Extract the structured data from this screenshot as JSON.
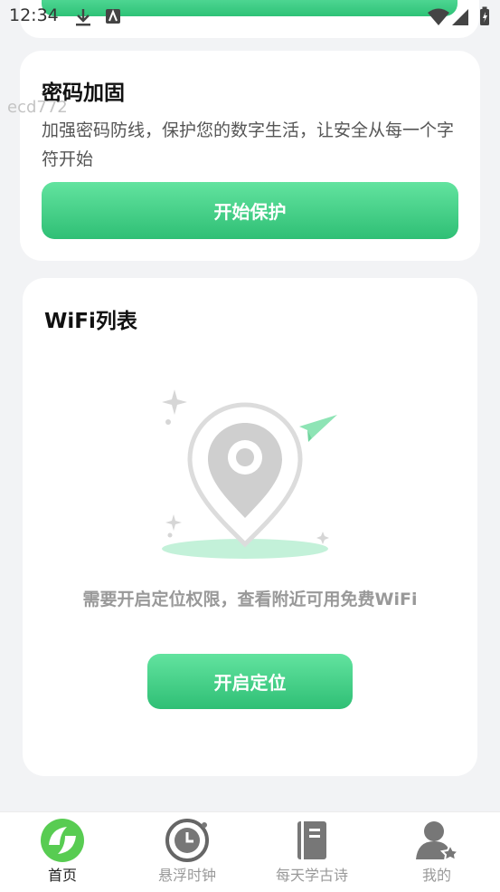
{
  "status_bar": {
    "time": "12:34"
  },
  "watermark": "ecd772",
  "password_card": {
    "title": "密码加固",
    "description": "加强密码防线，保护您的数字生活，让安全从每一个字符开始",
    "button": "开始保护"
  },
  "wifi_card": {
    "title": "WiFi列表",
    "empty_text": "需要开启定位权限，查看附近可用免费WiFi",
    "button": "开启定位"
  },
  "bottom_nav": {
    "items": [
      {
        "label": "首页",
        "icon": "home-icon",
        "active": true
      },
      {
        "label": "悬浮时钟",
        "icon": "clock-icon",
        "active": false
      },
      {
        "label": "每天学古诗",
        "icon": "book-icon",
        "active": false
      },
      {
        "label": "我的",
        "icon": "user-icon",
        "active": false
      }
    ]
  },
  "colors": {
    "accent": "#3ccb82",
    "background": "#f2f3f5"
  }
}
